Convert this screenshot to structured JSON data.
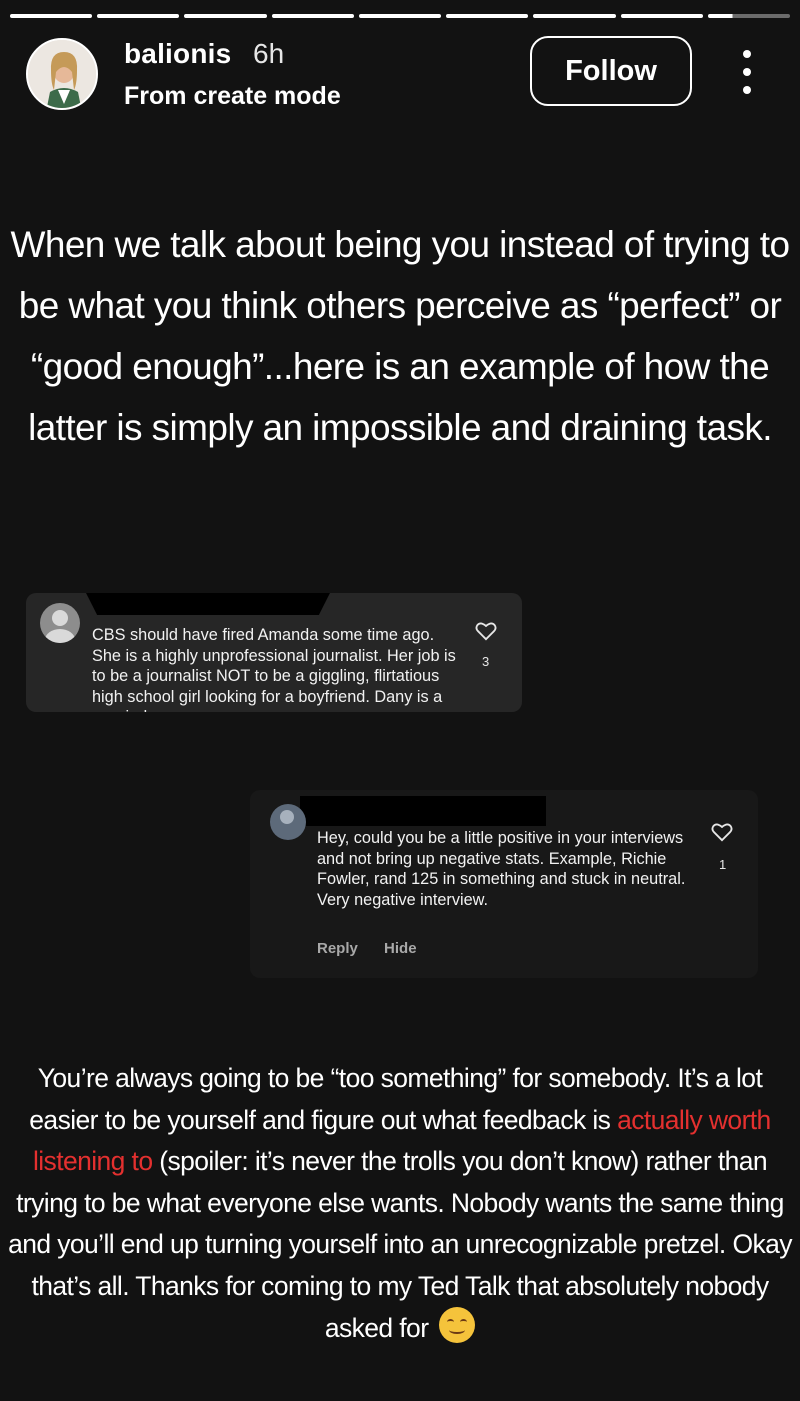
{
  "story": {
    "segments_total": 9,
    "segments_seen": 8,
    "current_segment_progress": 0.3
  },
  "header": {
    "username": "balionis",
    "time": "6h",
    "subtitle": "From create mode",
    "follow_label": "Follow",
    "more_icon": "more-vertical-icon"
  },
  "intro_text": "When we talk about being you instead of trying to be what you think others perceive as “perfect” or “good enough”...here is an example of how the latter is simply an impossible and draining task.",
  "comments": [
    {
      "text": "CBS should have fired Amanda some time ago. She is a highly unprofessional journalist. Her job is to be a journalist NOT to be a giggling, flirtatious high school girl looking for a boyfriend. Dany is a married",
      "likes": "3"
    },
    {
      "text": "Hey, could you be a little positive in your interviews and not bring up negative stats. Example, Richie Fowler, rand 125 in something and stuck in neutral. Very negative interview.",
      "likes": "1",
      "reply_label": "Reply",
      "hide_label": "Hide"
    }
  ],
  "outro": {
    "before_highlight": "You’re always going to be “too something” for somebody. It’s a lot easier to be yourself and figure out what feedback is ",
    "highlight": "actually worth listening to",
    "after_highlight": " (spoiler: it’s never the trolls you don’t know) rather than trying to be what everyone else wants. Nobody wants the same thing and you’ll end up turning yourself into an unrecognizable pretzel. Okay that’s all. Thanks for coming to my Ted Talk that absolutely nobody asked for ",
    "highlight_color": "#e4302f",
    "emoji": "smiling-face-emoji"
  }
}
